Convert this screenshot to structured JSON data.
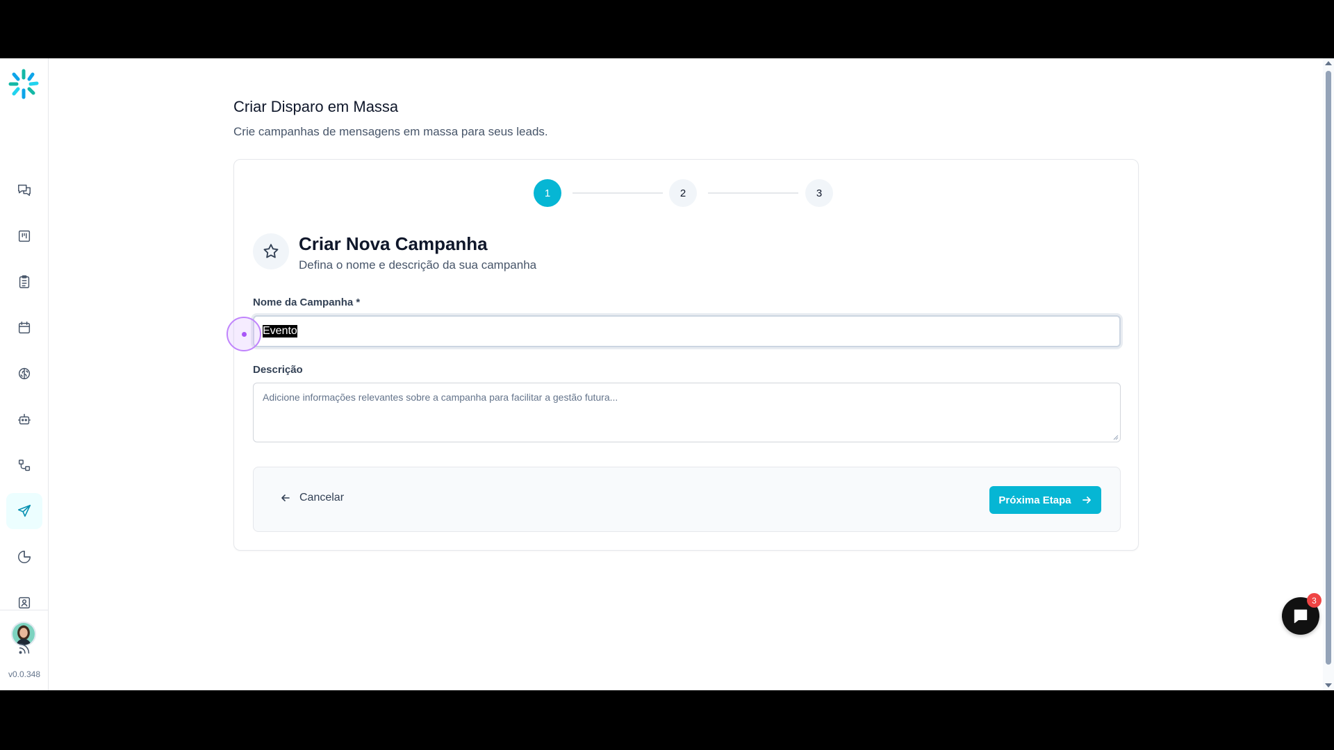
{
  "app": {
    "version": "v0.0.348"
  },
  "sidebar": {
    "items": [
      {
        "name": "conversations",
        "icon": "chat-bubbles-icon"
      },
      {
        "name": "kanban",
        "icon": "kanban-board-icon"
      },
      {
        "name": "tasks",
        "icon": "clipboard-list-icon"
      },
      {
        "name": "calendar",
        "icon": "calendar-icon"
      },
      {
        "name": "ai-brain",
        "icon": "brain-icon"
      },
      {
        "name": "bots",
        "icon": "bot-icon"
      },
      {
        "name": "workflows",
        "icon": "workflow-icon"
      },
      {
        "name": "mass-send",
        "icon": "send-icon",
        "active": true
      },
      {
        "name": "reports",
        "icon": "pie-chart-icon"
      },
      {
        "name": "contacts",
        "icon": "contact-card-icon"
      },
      {
        "name": "feeds",
        "icon": "rss-icon"
      }
    ]
  },
  "header": {
    "title": "Criar Disparo em Massa",
    "subtitle": "Crie campanhas de mensagens em massa para seus leads."
  },
  "stepper": {
    "steps": [
      "1",
      "2",
      "3"
    ],
    "current": 1
  },
  "section": {
    "title": "Criar Nova Campanha",
    "subtitle": "Defina o nome e descrição da sua campanha"
  },
  "form": {
    "name_label": "Nome da Campanha *",
    "name_value": "Evento",
    "description_label": "Descrição",
    "description_placeholder": "Adicione informações relevantes sobre a campanha para facilitar a gestão futura..."
  },
  "actions": {
    "cancel_label": "Cancelar",
    "next_label": "Próxima Etapa"
  },
  "chat": {
    "badge_count": "3"
  },
  "colors": {
    "accent": "#06b6d4",
    "badge": "#ef4444"
  }
}
